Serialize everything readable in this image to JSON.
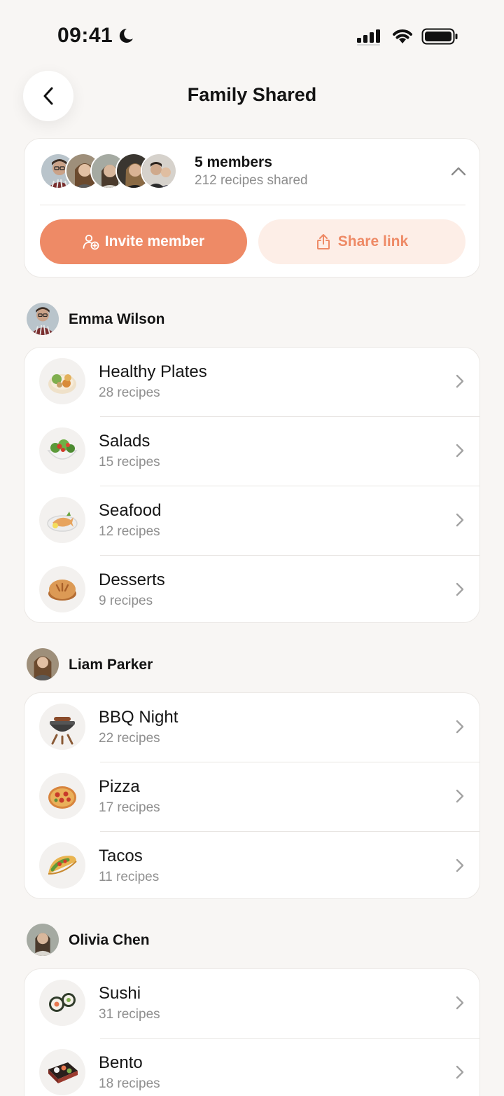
{
  "status_bar": {
    "time": "09:41"
  },
  "header": {
    "title": "Family Shared"
  },
  "members_card": {
    "members_count": "5 members",
    "recipes_shared": "212 recipes shared",
    "invite_label": "Invite member",
    "share_label": "Share link"
  },
  "sections": [
    {
      "member": "Emma Wilson",
      "categories": [
        {
          "title": "Healthy Plates",
          "count": "28 recipes"
        },
        {
          "title": "Salads",
          "count": "15 recipes"
        },
        {
          "title": "Seafood",
          "count": "12 recipes"
        },
        {
          "title": "Desserts",
          "count": "9 recipes"
        }
      ]
    },
    {
      "member": "Liam Parker",
      "categories": [
        {
          "title": "BBQ Night",
          "count": "22 recipes"
        },
        {
          "title": "Pizza",
          "count": "17 recipes"
        },
        {
          "title": "Tacos",
          "count": "11 recipes"
        }
      ]
    },
    {
      "member": "Olivia Chen",
      "categories": [
        {
          "title": "Sushi",
          "count": "31 recipes"
        },
        {
          "title": "Bento",
          "count": "18 recipes"
        }
      ]
    }
  ],
  "colors": {
    "accent": "#ee8a66",
    "accent_soft": "#fdeee7",
    "background": "#f8f6f4",
    "muted_text": "#8e8e8e"
  }
}
